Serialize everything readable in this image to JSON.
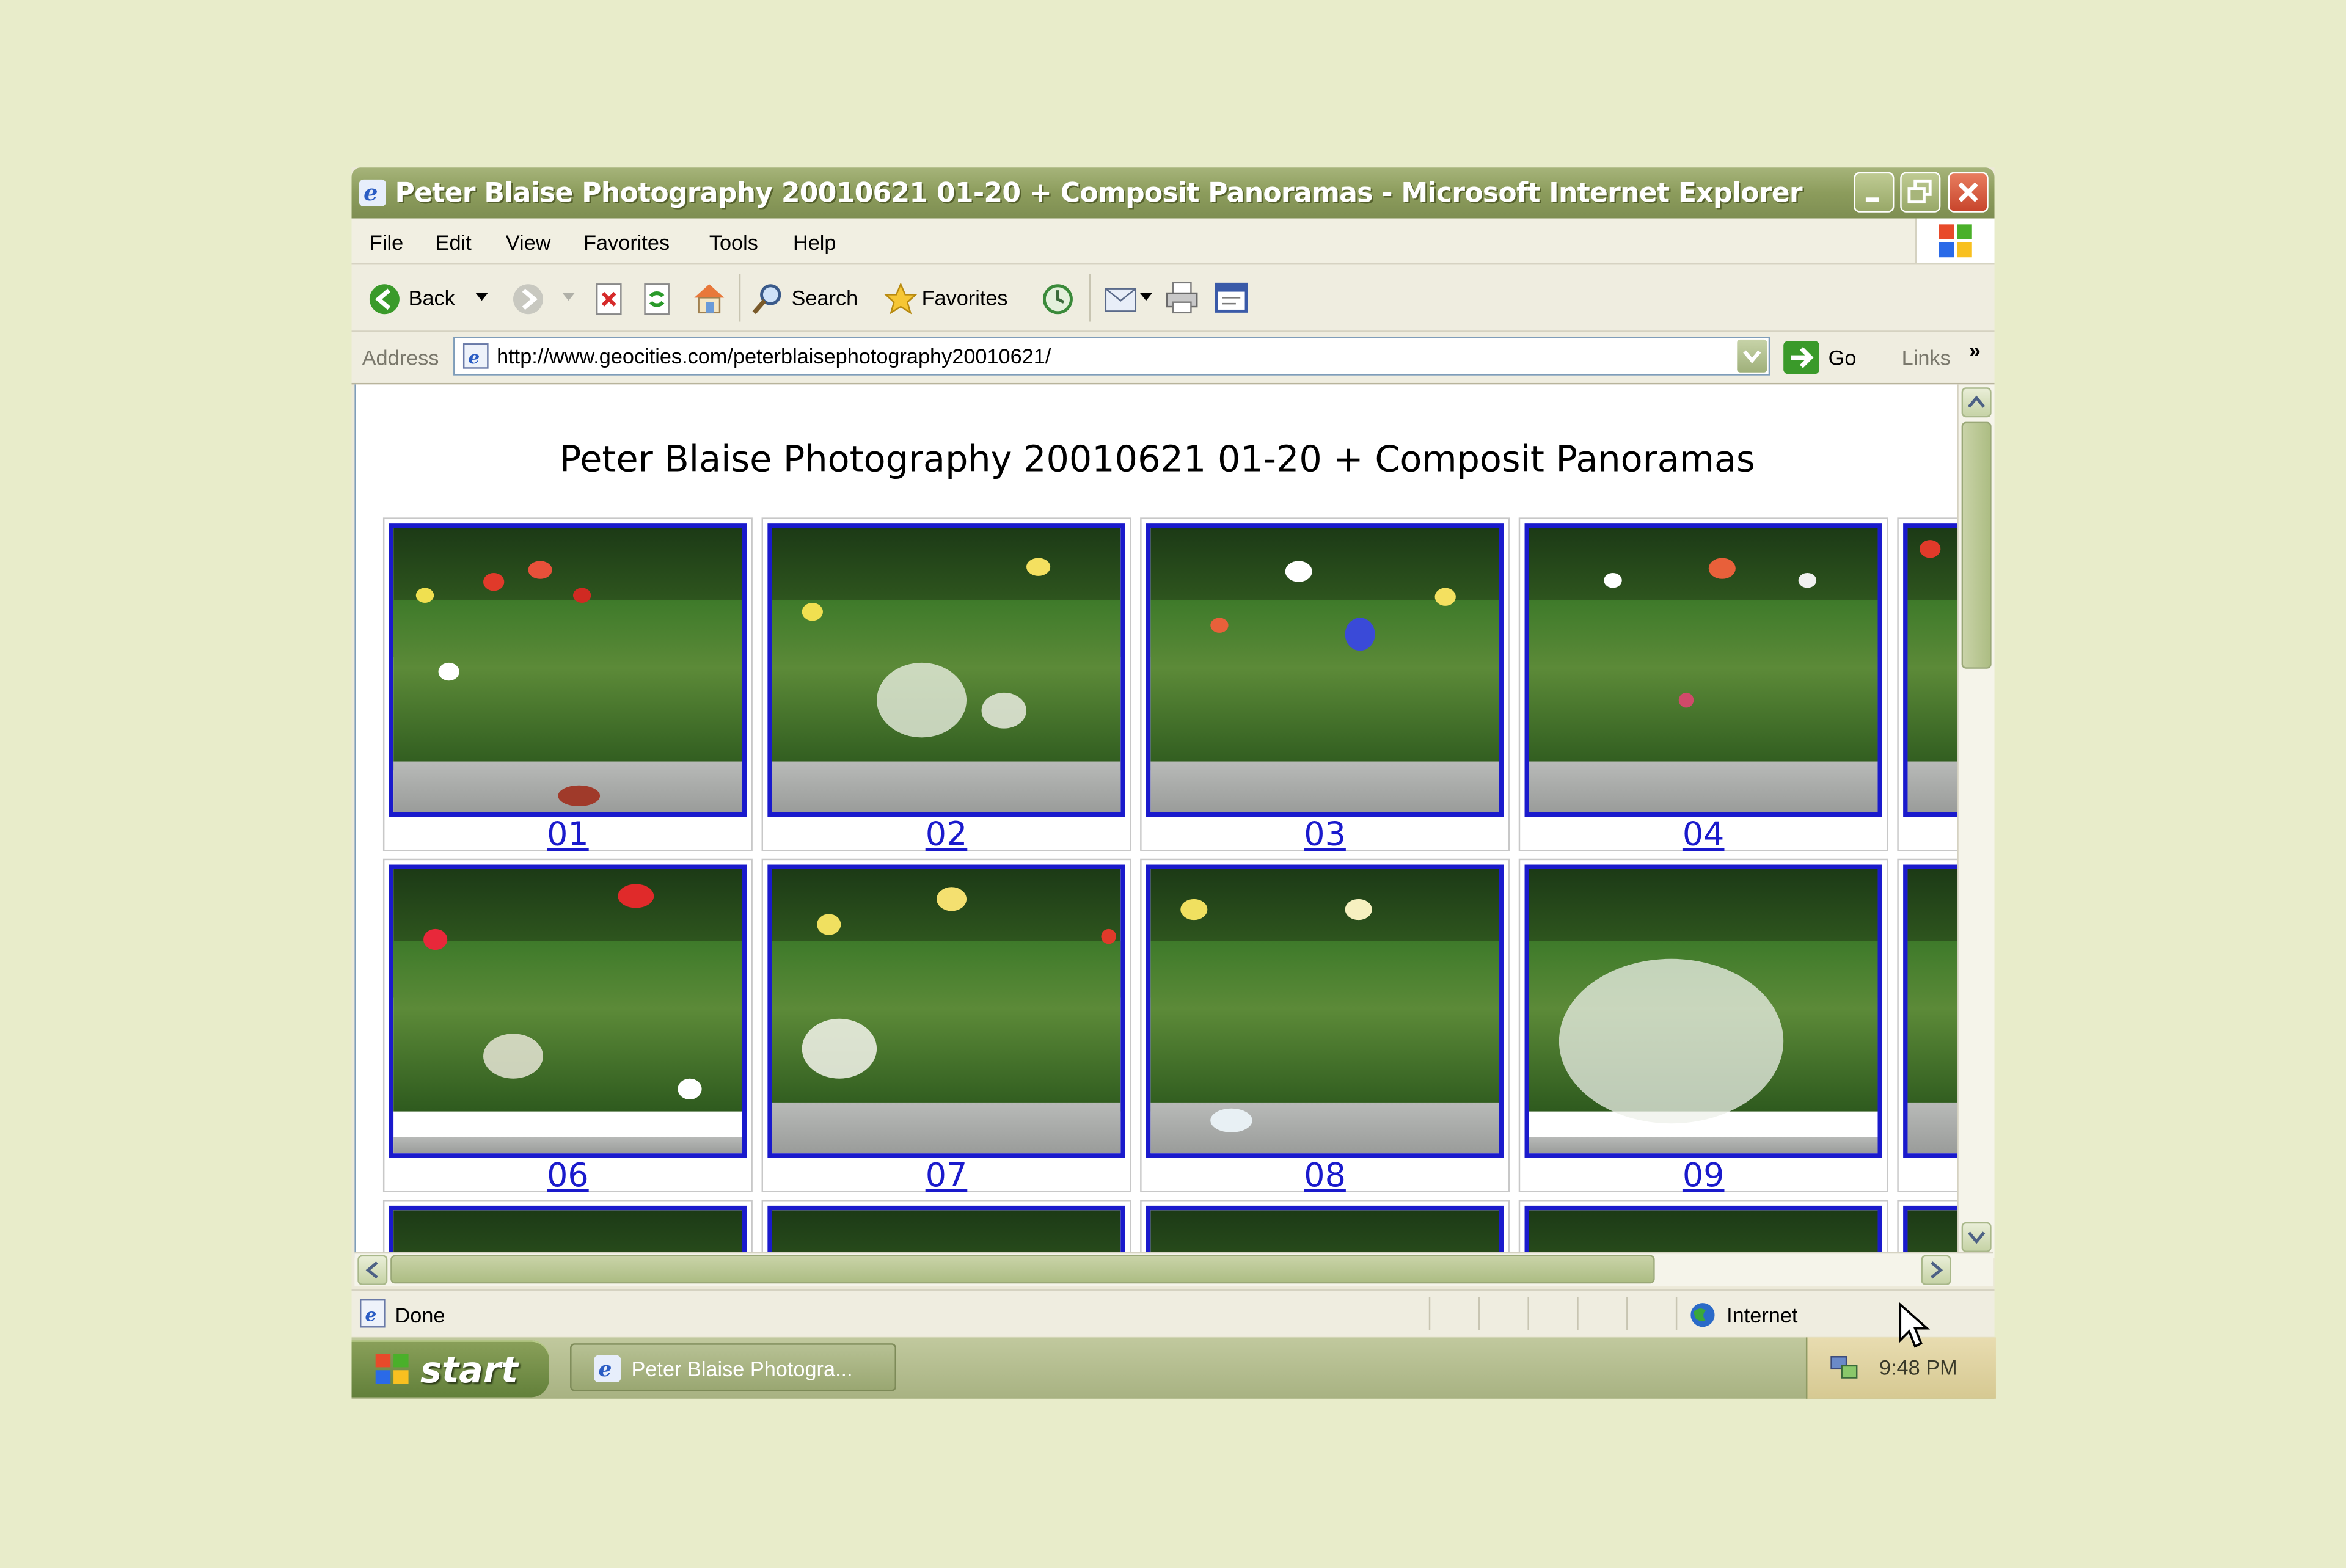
{
  "window": {
    "title": "Peter Blaise Photography 20010621 01-20 + Composit Panoramas - Microsoft Internet Explorer"
  },
  "menu": [
    "File",
    "Edit",
    "View",
    "Favorites",
    "Tools",
    "Help"
  ],
  "toolbar": {
    "back": "Back",
    "search": "Search",
    "favorites": "Favorites"
  },
  "address": {
    "label": "Address",
    "url": "http://www.geocities.com/peterblaisephotography20010621/",
    "go": "Go",
    "links": "Links",
    "chevron": "»"
  },
  "page": {
    "heading": "Peter Blaise Photography 20010621 01-20 + Composit Panoramas",
    "row1": [
      "01",
      "02",
      "03",
      "04"
    ],
    "row2": [
      "06",
      "07",
      "08",
      "09"
    ]
  },
  "status": {
    "text": "Done",
    "zone": "Internet"
  },
  "taskbar": {
    "start": "start",
    "task": "Peter Blaise Photogra...",
    "clock": "9:48 PM"
  },
  "colors": {
    "desktop_bg": "#e8ecca",
    "link_blue": "#1a1acc",
    "titlebar": "#8c9c5c"
  }
}
